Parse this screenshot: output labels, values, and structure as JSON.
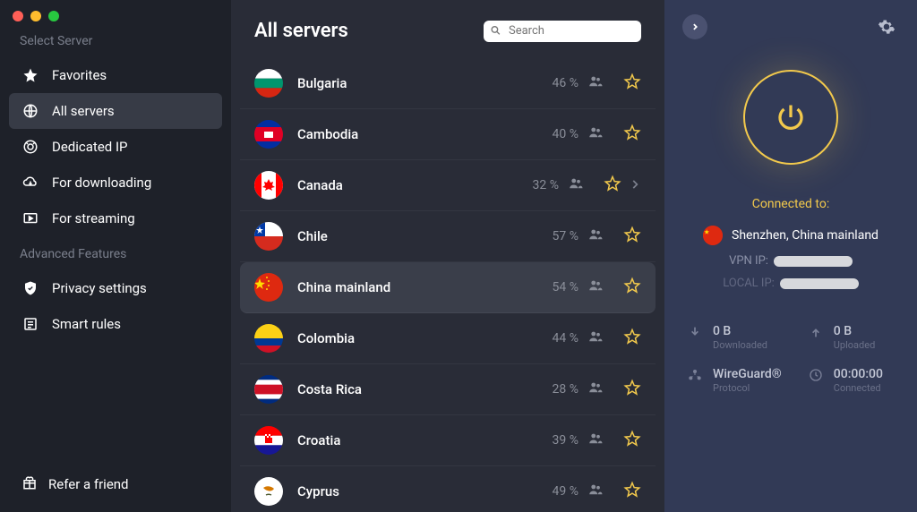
{
  "sidebar": {
    "section_label": "Select Server",
    "items": [
      {
        "label": "Favorites",
        "icon": "star"
      },
      {
        "label": "All servers",
        "icon": "globe",
        "active": true
      },
      {
        "label": "Dedicated IP",
        "icon": "dedicated"
      },
      {
        "label": "For downloading",
        "icon": "cloud-down"
      },
      {
        "label": "For streaming",
        "icon": "play"
      }
    ],
    "advanced_label": "Advanced Features",
    "advanced_items": [
      {
        "label": "Privacy settings",
        "icon": "shield"
      },
      {
        "label": "Smart rules",
        "icon": "rules"
      }
    ],
    "refer_label": "Refer a friend"
  },
  "main": {
    "title": "All servers",
    "search_placeholder": "Search",
    "servers": [
      {
        "name": "Bulgaria",
        "load": "46 %",
        "flag": "bg"
      },
      {
        "name": "Cambodia",
        "load": "40 %",
        "flag": "kh"
      },
      {
        "name": "Canada",
        "load": "32 %",
        "flag": "ca",
        "expandable": true
      },
      {
        "name": "Chile",
        "load": "57 %",
        "flag": "cl"
      },
      {
        "name": "China mainland",
        "load": "54 %",
        "flag": "cn",
        "selected": true
      },
      {
        "name": "Colombia",
        "load": "44 %",
        "flag": "co"
      },
      {
        "name": "Costa Rica",
        "load": "28 %",
        "flag": "cr"
      },
      {
        "name": "Croatia",
        "load": "39 %",
        "flag": "hr"
      },
      {
        "name": "Cyprus",
        "load": "49 %",
        "flag": "cy"
      }
    ]
  },
  "panel": {
    "connected_label": "Connected to:",
    "location": "Shenzhen, China mainland",
    "vpn_ip_label": "VPN IP:",
    "local_ip_label": "LOCAL IP:",
    "download_val": "0 B",
    "download_sub": "Downloaded",
    "upload_val": "0 B",
    "upload_sub": "Uploaded",
    "protocol_val": "WireGuard®",
    "protocol_sub": "Protocol",
    "time_val": "00:00:00",
    "time_sub": "Connected"
  }
}
